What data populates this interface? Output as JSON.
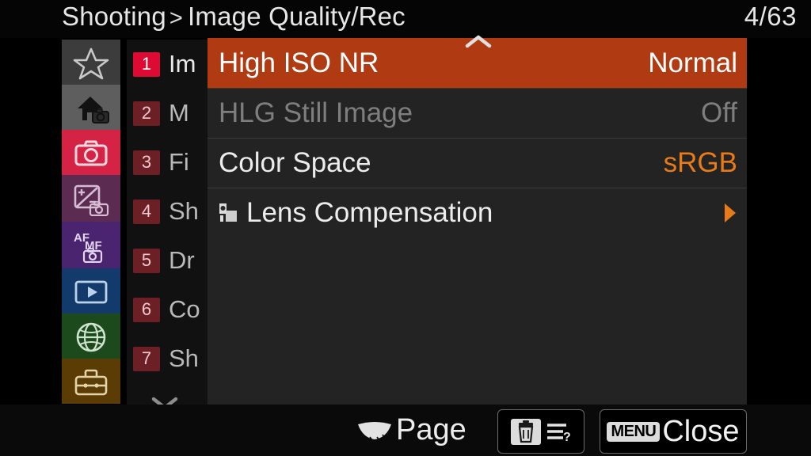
{
  "header": {
    "breadcrumb_root": "Shooting",
    "breadcrumb_separator": ">",
    "breadcrumb_current": "Image Quality/Rec",
    "page_counter": "4/63"
  },
  "rail": {
    "items": [
      {
        "name": "my-menu",
        "icon": "star-icon",
        "color": "#3c3c3c",
        "active": false
      },
      {
        "name": "main-menu",
        "icon": "home-camera-icon",
        "color": "#5e5e5e",
        "active": false
      },
      {
        "name": "shooting",
        "icon": "camera-icon",
        "color": "#d42344",
        "active": true
      },
      {
        "name": "exposure",
        "icon": "exposure-plus-minus-camera-icon",
        "color": "#5c2b52",
        "active": false
      },
      {
        "name": "focus",
        "icon": "af-mf-camera-icon",
        "color": "#4b2470",
        "active": false
      },
      {
        "name": "playback",
        "icon": "playback-icon",
        "color": "#123a6b",
        "active": false
      },
      {
        "name": "network",
        "icon": "globe-icon",
        "color": "#1c4a1c",
        "active": false
      },
      {
        "name": "setup",
        "icon": "toolbox-icon",
        "color": "#5b3c05",
        "active": false
      }
    ],
    "scroll_down_icon": "chevron-down-icon"
  },
  "tabs": {
    "items": [
      {
        "number": "1",
        "label": "Im",
        "active": true
      },
      {
        "number": "2",
        "label": "M",
        "active": false
      },
      {
        "number": "3",
        "label": "Fi",
        "active": false
      },
      {
        "number": "4",
        "label": "Sh",
        "active": false
      },
      {
        "number": "5",
        "label": "Dr",
        "active": false
      },
      {
        "number": "6",
        "label": "Co",
        "active": false
      },
      {
        "number": "7",
        "label": "Sh",
        "active": false
      }
    ]
  },
  "panel": {
    "scroll_up_icon": "chevron-up-icon",
    "rows": [
      {
        "label": "High ISO NR",
        "value": "Normal",
        "state": "selected",
        "value_style": "plain",
        "leading_icon": "",
        "trailing_icon": ""
      },
      {
        "label": "HLG Still Image",
        "value": "Off",
        "state": "disabled",
        "value_style": "plain",
        "leading_icon": "",
        "trailing_icon": ""
      },
      {
        "label": "Color Space",
        "value": "sRGB",
        "state": "normal",
        "value_style": "accent",
        "leading_icon": "",
        "trailing_icon": ""
      },
      {
        "label": "Lens Compensation",
        "value": "",
        "state": "normal",
        "value_style": "plain",
        "leading_icon": "submenu-icon",
        "trailing_icon": "chevron-right-icon"
      }
    ]
  },
  "bottom_bar": {
    "dial_icon": "control-dial-icon",
    "page_label": "Page",
    "trash_icon": "trash-icon",
    "help_icon": "help-list-icon",
    "menu_badge": "MENU",
    "close_label": "Close"
  },
  "colors": {
    "selection_highlight": "#b03a12",
    "accent_orange": "#e87b18",
    "active_tab_red": "#dd0a33",
    "panel_background": "#232323",
    "screen_background": "#000000"
  }
}
